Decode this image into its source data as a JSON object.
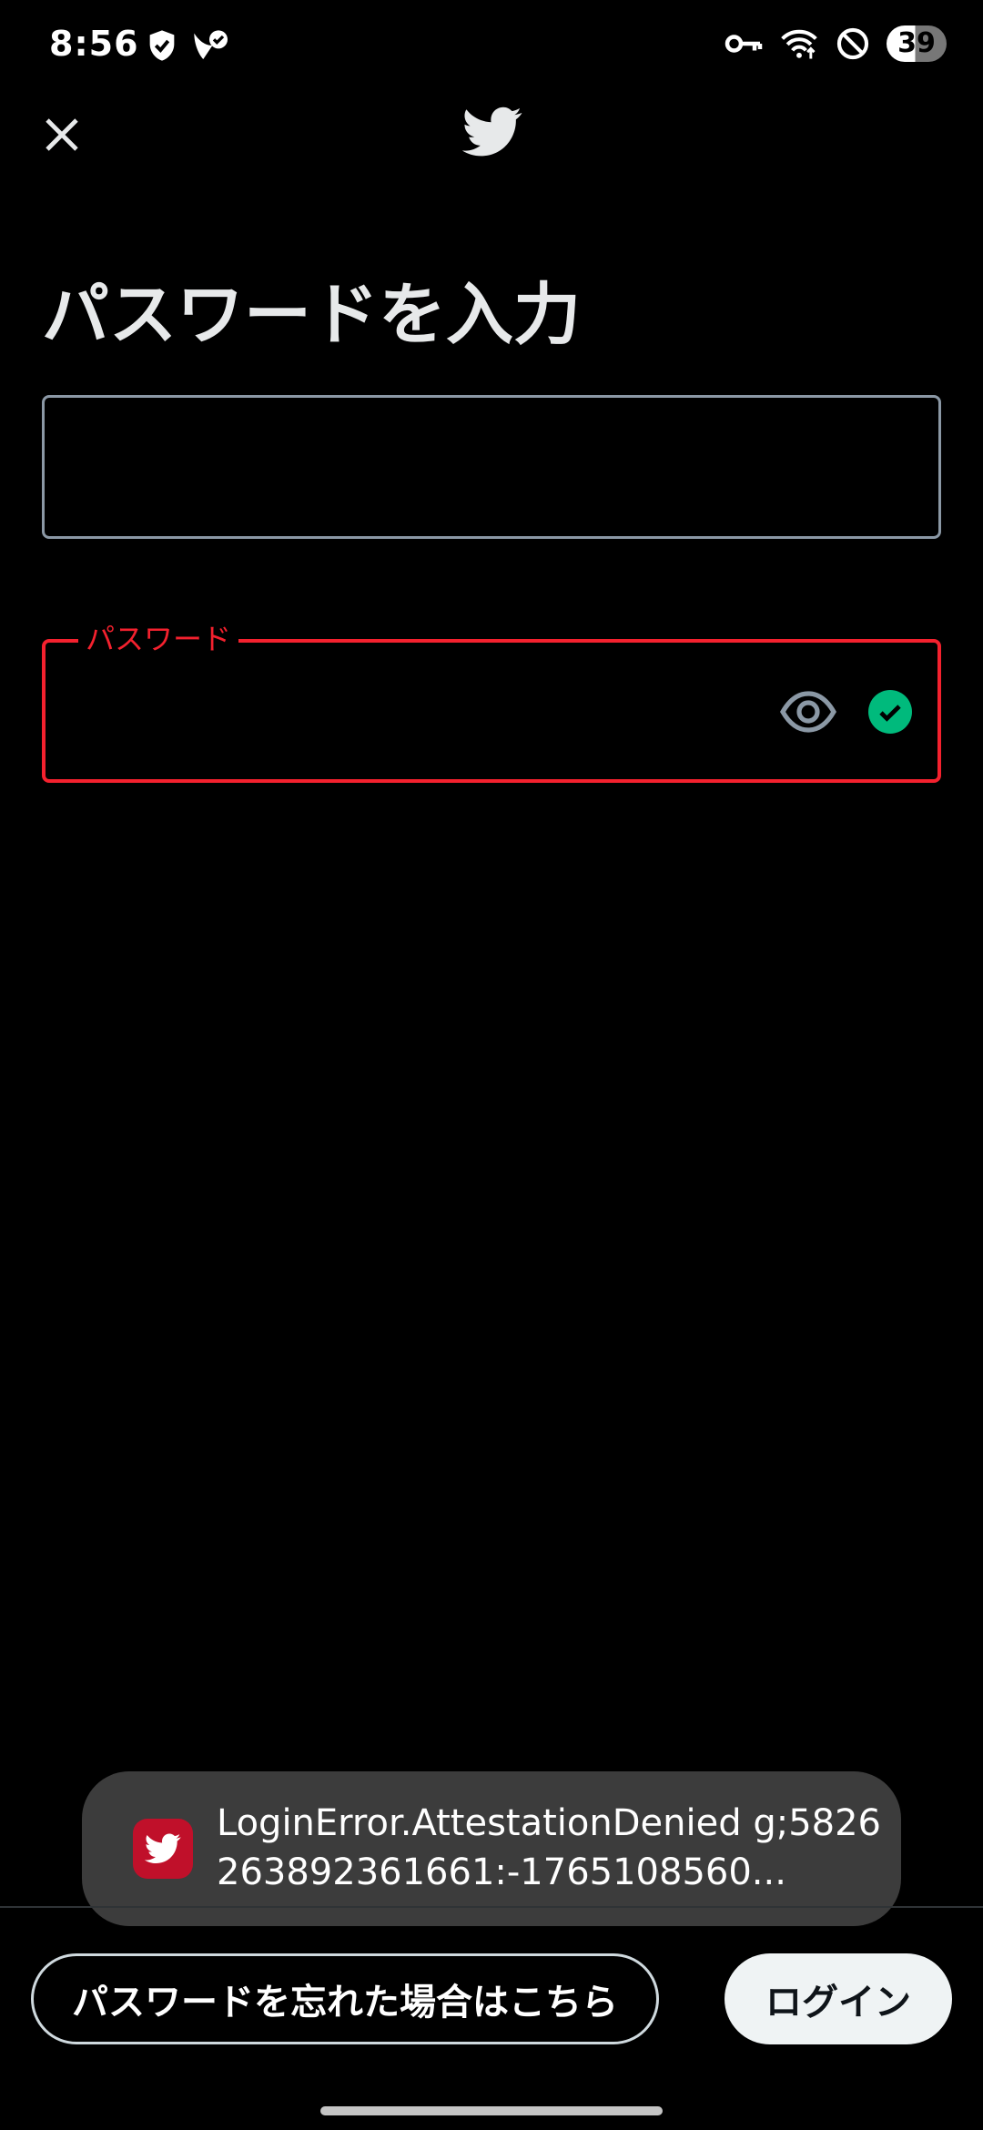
{
  "status_bar": {
    "time": "8:56",
    "battery_level": "39",
    "left_icons": [
      "shield-check-icon",
      "bird-check-icon"
    ],
    "right_icons": [
      "vpn-key-icon",
      "wifi-icon",
      "do-not-disturb-icon"
    ]
  },
  "header": {
    "close_icon": "close-icon",
    "logo_icon": "twitter-bird-icon"
  },
  "page": {
    "title": "パスワードを入力"
  },
  "username_field": {
    "value": ""
  },
  "password_field": {
    "label": "パスワード",
    "value": "",
    "visibility_icon": "eye-icon",
    "status_icon": "check-circle-icon"
  },
  "toast": {
    "icon": "twitter-app-icon",
    "message": "LoginError.AttestationDenied g;5826263892361661:-1765108560..."
  },
  "bottom_bar": {
    "forgot_password_label": "パスワードを忘れた場合はこちら",
    "login_label": "ログイン"
  },
  "colors": {
    "background": "#000000",
    "error": "#f4212e",
    "success": "#00ba7c",
    "toast_bg": "#3c3c3c"
  }
}
